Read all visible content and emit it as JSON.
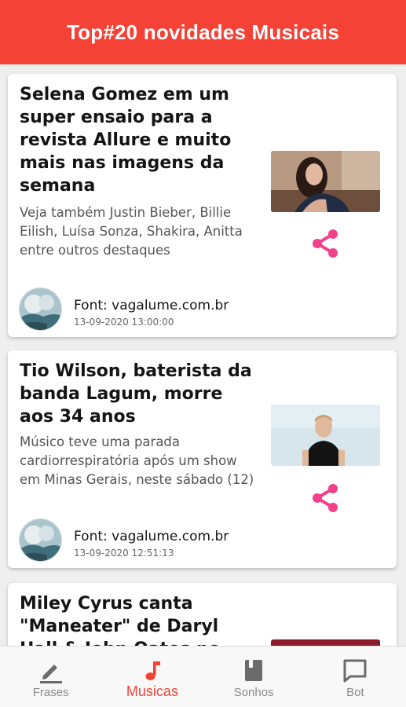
{
  "header": {
    "title": "Top#20 novidades Musicais"
  },
  "colors": {
    "header": "#f44336",
    "share": "#f0418a",
    "active_tab": "#f44336",
    "inactive_tab": "#8a8a8a"
  },
  "articles": [
    {
      "title": "Selena Gomez em um super ensaio para a revista Allure e muito mais nas imagens da semana",
      "description": "Veja também Justin Bieber, Billie Eilish, Luísa Sonza, Shakira, Anitta entre outros destaques",
      "source": "Font: vagalume.com.br",
      "date": "13-09-2020 13:00:00",
      "thumbnail_icon": "photo-woman-icon",
      "share_icon": "share-icon"
    },
    {
      "title": "Tio Wilson, baterista da banda Lagum, morre aos 34 anos",
      "description": "Músico teve uma parada cardiorrespiratória após um show em Minas Gerais, neste sábado (12)",
      "source": "Font: vagalume.com.br",
      "date": "13-09-2020 12:51:13",
      "thumbnail_icon": "photo-man-icon",
      "share_icon": "share-icon"
    },
    {
      "title": "Miley Cyrus canta \"Maneater\" de Daryl Hall & John Oates no"
    }
  ],
  "bottom_nav": {
    "items": [
      {
        "label": "Frases",
        "icon": "pen-icon",
        "active": false
      },
      {
        "label": "Musicas",
        "icon": "music-note-icon",
        "active": true
      },
      {
        "label": "Sonhos",
        "icon": "book-icon",
        "active": false
      },
      {
        "label": "Bot",
        "icon": "chat-icon",
        "active": false
      }
    ]
  }
}
